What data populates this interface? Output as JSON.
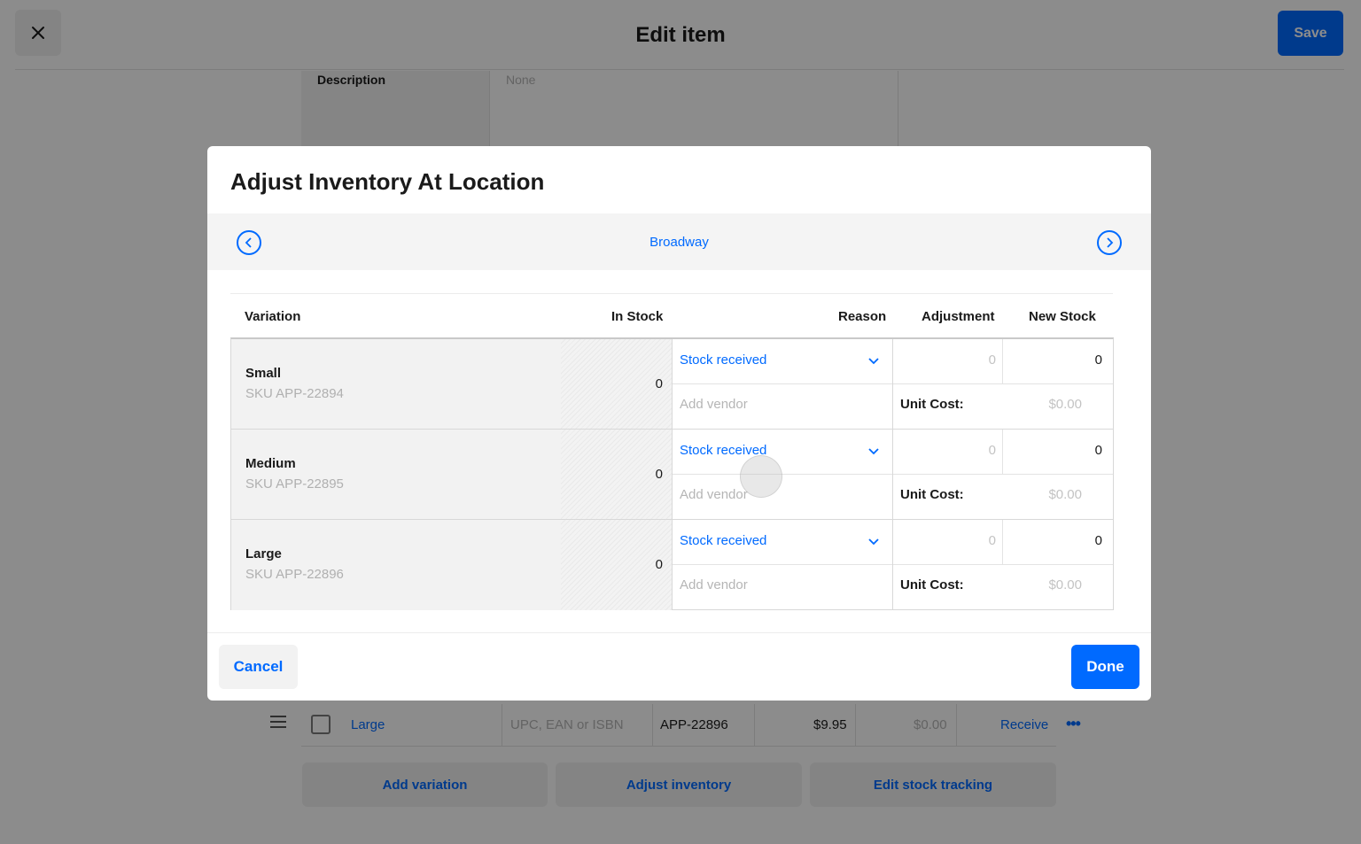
{
  "header": {
    "title": "Edit item",
    "save_label": "Save"
  },
  "background": {
    "description_label": "Description",
    "description_placeholder": "None",
    "variation_row": {
      "name": "Large",
      "upc_placeholder": "UPC, EAN or ISBN",
      "sku": "APP-22896",
      "price": "$9.95",
      "cost": "$0.00",
      "receive_label": "Receive",
      "more_label": "•••"
    },
    "buttons": {
      "add_variation": "Add variation",
      "adjust_inventory": "Adjust inventory",
      "edit_stock_tracking": "Edit stock tracking"
    }
  },
  "modal": {
    "title": "Adjust Inventory At Location",
    "location": "Broadway",
    "columns": {
      "variation": "Variation",
      "in_stock": "In Stock",
      "reason": "Reason",
      "adjustment": "Adjustment",
      "new_stock": "New Stock"
    },
    "rows": [
      {
        "name": "Small",
        "sku": "SKU APP-22894",
        "in_stock": "0",
        "reason": "Stock received",
        "vendor_placeholder": "Add vendor",
        "adjustment_placeholder": "0",
        "new_stock": "0",
        "unit_cost_label": "Unit Cost:",
        "unit_cost_placeholder": "$0.00"
      },
      {
        "name": "Medium",
        "sku": "SKU APP-22895",
        "in_stock": "0",
        "reason": "Stock received",
        "vendor_placeholder": "Add vendor",
        "adjustment_placeholder": "0",
        "new_stock": "0",
        "unit_cost_label": "Unit Cost:",
        "unit_cost_placeholder": "$0.00"
      },
      {
        "name": "Large",
        "sku": "SKU APP-22896",
        "in_stock": "0",
        "reason": "Stock received",
        "vendor_placeholder": "Add vendor",
        "adjustment_placeholder": "0",
        "new_stock": "0",
        "unit_cost_label": "Unit Cost:",
        "unit_cost_placeholder": "$0.00"
      }
    ],
    "cancel_label": "Cancel",
    "done_label": "Done"
  },
  "colors": {
    "accent": "#006aff",
    "overlay": "rgba(0,0,0,0.45)"
  },
  "icons": {
    "close": "close-icon",
    "prev_location": "chevron-left-icon",
    "next_location": "chevron-right-icon",
    "reason_dropdown": "chevron-down-icon",
    "drag": "drag-handle-icon"
  }
}
